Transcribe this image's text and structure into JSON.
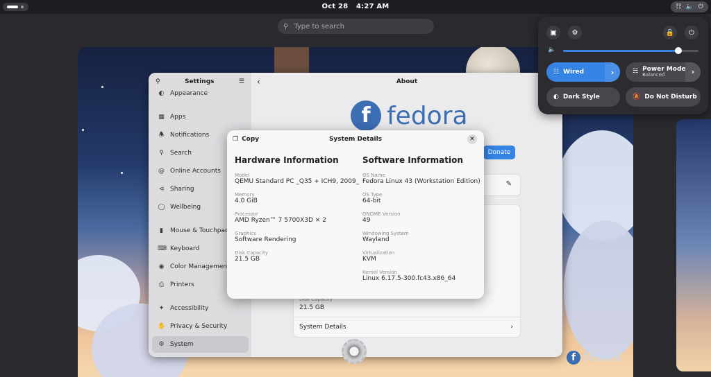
{
  "topbar": {
    "date": "Oct 28",
    "time": "4:27 AM"
  },
  "search": {
    "placeholder": "Type to search"
  },
  "settings": {
    "sidebar_title": "Settings",
    "items": [
      {
        "label": "Appearance",
        "icon": "appearance-icon"
      },
      {
        "label": "Apps",
        "icon": "apps-icon"
      },
      {
        "label": "Notifications",
        "icon": "bell-icon"
      },
      {
        "label": "Search",
        "icon": "search-icon"
      },
      {
        "label": "Online Accounts",
        "icon": "at-icon"
      },
      {
        "label": "Sharing",
        "icon": "share-icon"
      },
      {
        "label": "Wellbeing",
        "icon": "wellbeing-icon"
      },
      {
        "label": "Mouse & Touchpad",
        "icon": "mouse-icon"
      },
      {
        "label": "Keyboard",
        "icon": "keyboard-icon"
      },
      {
        "label": "Color Management",
        "icon": "color-icon"
      },
      {
        "label": "Printers",
        "icon": "printer-icon"
      },
      {
        "label": "Accessibility",
        "icon": "accessibility-icon"
      },
      {
        "label": "Privacy & Security",
        "icon": "hand-icon"
      },
      {
        "label": "System",
        "icon": "gear-icon"
      }
    ],
    "page_title": "About",
    "logo_text": "fedora",
    "donate_label": "Donate",
    "disk_label": "Disk Capacity",
    "disk_value": "21.5 GB",
    "system_details_label": "System Details"
  },
  "dialog": {
    "copy_label": "Copy",
    "title": "System Details",
    "hardware": {
      "heading": "Hardware Information",
      "fields": [
        {
          "label": "Model",
          "value": "QEMU Standard PC _Q35 + ICH9, 2009_"
        },
        {
          "label": "Memory",
          "value": "4.0 GiB"
        },
        {
          "label": "Processor",
          "value": "AMD Ryzen™ 7 5700X3D × 2"
        },
        {
          "label": "Graphics",
          "value": "Software Rendering"
        },
        {
          "label": "Disk Capacity",
          "value": "21.5 GB"
        }
      ]
    },
    "software": {
      "heading": "Software Information",
      "fields": [
        {
          "label": "OS Name",
          "value": "Fedora Linux 43 (Workstation Edition)"
        },
        {
          "label": "OS Type",
          "value": "64-bit"
        },
        {
          "label": "GNOME Version",
          "value": "49"
        },
        {
          "label": "Windowing System",
          "value": "Wayland"
        },
        {
          "label": "Virtualization",
          "value": "KVM"
        },
        {
          "label": "Kernel Version",
          "value": "Linux 6.17.5-300.fc43.x86_64"
        }
      ]
    }
  },
  "quick_settings": {
    "volume_level": 0.85,
    "wired_label": "Wired",
    "power_mode_label": "Power Mode",
    "power_mode_value": "Balanced",
    "dark_style_label": "Dark Style",
    "dnd_label": "Do Not Disturb",
    "accent_color": "#3584e4"
  },
  "wallpaper_logo": "fedora"
}
